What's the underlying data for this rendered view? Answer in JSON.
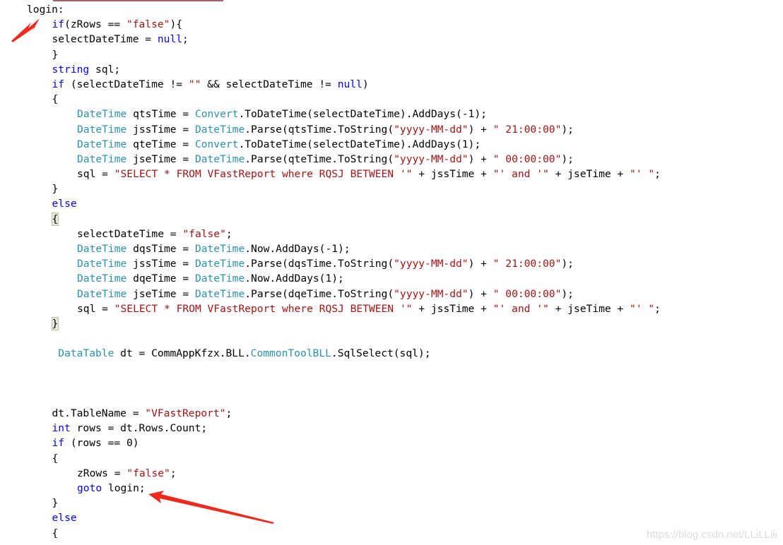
{
  "code_lines": [
    {
      "indent": 0,
      "tokens": [
        [
          "plain",
          "login:"
        ]
      ]
    },
    {
      "indent": 1,
      "tokens": [
        [
          "kw",
          "if"
        ],
        [
          "plain",
          "(zRows == "
        ],
        [
          "str",
          "\"false\""
        ],
        [
          "plain",
          "){"
        ]
      ]
    },
    {
      "indent": 1,
      "tokens": [
        [
          "plain",
          "selectDateTime = "
        ],
        [
          "kw",
          "null"
        ],
        [
          "plain",
          ";"
        ]
      ]
    },
    {
      "indent": 1,
      "tokens": [
        [
          "plain",
          "}"
        ]
      ]
    },
    {
      "indent": 1,
      "tokens": [
        [
          "kw",
          "string"
        ],
        [
          "plain",
          " sql;"
        ]
      ]
    },
    {
      "indent": 1,
      "tokens": [
        [
          "kw",
          "if"
        ],
        [
          "plain",
          " (selectDateTime != "
        ],
        [
          "str",
          "\"\""
        ],
        [
          "plain",
          " && selectDateTime != "
        ],
        [
          "kw",
          "null"
        ],
        [
          "plain",
          ")"
        ]
      ]
    },
    {
      "indent": 1,
      "tokens": [
        [
          "plain",
          "{"
        ]
      ]
    },
    {
      "indent": 2,
      "tokens": [
        [
          "type",
          "DateTime"
        ],
        [
          "plain",
          " qtsTime = "
        ],
        [
          "type",
          "Convert"
        ],
        [
          "plain",
          ".ToDateTime(selectDateTime).AddDays(-1);"
        ]
      ]
    },
    {
      "indent": 2,
      "tokens": [
        [
          "type",
          "DateTime"
        ],
        [
          "plain",
          " jssTime = "
        ],
        [
          "type",
          "DateTime"
        ],
        [
          "plain",
          ".Parse(qtsTime.ToString("
        ],
        [
          "str",
          "\"yyyy-MM-dd\""
        ],
        [
          "plain",
          ") + "
        ],
        [
          "str",
          "\" 21:00:00\""
        ],
        [
          "plain",
          ");"
        ]
      ]
    },
    {
      "indent": 2,
      "tokens": [
        [
          "type",
          "DateTime"
        ],
        [
          "plain",
          " qteTime = "
        ],
        [
          "type",
          "Convert"
        ],
        [
          "plain",
          ".ToDateTime(selectDateTime).AddDays(1);"
        ]
      ]
    },
    {
      "indent": 2,
      "tokens": [
        [
          "type",
          "DateTime"
        ],
        [
          "plain",
          " jseTime = "
        ],
        [
          "type",
          "DateTime"
        ],
        [
          "plain",
          ".Parse(qteTime.ToString("
        ],
        [
          "str",
          "\"yyyy-MM-dd\""
        ],
        [
          "plain",
          ") + "
        ],
        [
          "str",
          "\" 00:00:00\""
        ],
        [
          "plain",
          ");"
        ]
      ]
    },
    {
      "indent": 2,
      "tokens": [
        [
          "plain",
          "sql = "
        ],
        [
          "str",
          "\"SELECT * FROM VFastReport where RQSJ BETWEEN '\""
        ],
        [
          "plain",
          " + jssTime + "
        ],
        [
          "str",
          "\"' and '\""
        ],
        [
          "plain",
          " + jseTime + "
        ],
        [
          "str",
          "\"' \""
        ],
        [
          "plain",
          ";"
        ]
      ]
    },
    {
      "indent": 1,
      "tokens": [
        [
          "plain",
          "}"
        ]
      ]
    },
    {
      "indent": 1,
      "tokens": [
        [
          "kw",
          "else"
        ]
      ]
    },
    {
      "indent": 1,
      "tokens": [
        [
          "hl",
          "{"
        ]
      ]
    },
    {
      "indent": 2,
      "tokens": [
        [
          "plain",
          "selectDateTime = "
        ],
        [
          "str",
          "\"false\""
        ],
        [
          "plain",
          ";"
        ]
      ]
    },
    {
      "indent": 2,
      "tokens": [
        [
          "type",
          "DateTime"
        ],
        [
          "plain",
          " dqsTime = "
        ],
        [
          "type",
          "DateTime"
        ],
        [
          "plain",
          ".Now.AddDays(-1);"
        ]
      ]
    },
    {
      "indent": 2,
      "tokens": [
        [
          "type",
          "DateTime"
        ],
        [
          "plain",
          " jssTime = "
        ],
        [
          "type",
          "DateTime"
        ],
        [
          "plain",
          ".Parse(dqsTime.ToString("
        ],
        [
          "str",
          "\"yyyy-MM-dd\""
        ],
        [
          "plain",
          ") + "
        ],
        [
          "str",
          "\" 21:00:00\""
        ],
        [
          "plain",
          ");"
        ]
      ]
    },
    {
      "indent": 2,
      "tokens": [
        [
          "type",
          "DateTime"
        ],
        [
          "plain",
          " dqeTime = "
        ],
        [
          "type",
          "DateTime"
        ],
        [
          "plain",
          ".Now.AddDays(1);"
        ]
      ]
    },
    {
      "indent": 2,
      "tokens": [
        [
          "type",
          "DateTime"
        ],
        [
          "plain",
          " jseTime = "
        ],
        [
          "type",
          "DateTime"
        ],
        [
          "plain",
          ".Parse(dqeTime.ToString("
        ],
        [
          "str",
          "\"yyyy-MM-dd\""
        ],
        [
          "plain",
          ") + "
        ],
        [
          "str",
          "\" 00:00:00\""
        ],
        [
          "plain",
          ");"
        ]
      ]
    },
    {
      "indent": 2,
      "tokens": [
        [
          "plain",
          "sql = "
        ],
        [
          "str",
          "\"SELECT * FROM VFastReport where RQSJ BETWEEN '\""
        ],
        [
          "plain",
          " + jssTime + "
        ],
        [
          "str",
          "\"' and '\""
        ],
        [
          "plain",
          " + jseTime + "
        ],
        [
          "str",
          "\"' \""
        ],
        [
          "plain",
          ";"
        ]
      ]
    },
    {
      "indent": 1,
      "tokens": [
        [
          "hl",
          "}"
        ]
      ]
    },
    {
      "indent": 0,
      "tokens": []
    },
    {
      "indent": 1,
      "tokens": [
        [
          "plain",
          " "
        ],
        [
          "type",
          "DataTable"
        ],
        [
          "plain",
          " dt = CommAppKfzx.BLL."
        ],
        [
          "type",
          "CommonToolBLL"
        ],
        [
          "plain",
          ".SqlSelect(sql);"
        ]
      ]
    },
    {
      "indent": 0,
      "tokens": []
    },
    {
      "indent": 0,
      "tokens": []
    },
    {
      "indent": 0,
      "tokens": []
    },
    {
      "indent": 1,
      "tokens": [
        [
          "plain",
          "dt.TableName = "
        ],
        [
          "str",
          "\"VFastReport\""
        ],
        [
          "plain",
          ";"
        ]
      ]
    },
    {
      "indent": 1,
      "tokens": [
        [
          "kw",
          "int"
        ],
        [
          "plain",
          " rows = dt.Rows.Count;"
        ]
      ]
    },
    {
      "indent": 1,
      "tokens": [
        [
          "kw",
          "if"
        ],
        [
          "plain",
          " (rows == 0)"
        ]
      ]
    },
    {
      "indent": 1,
      "tokens": [
        [
          "plain",
          "{"
        ]
      ]
    },
    {
      "indent": 2,
      "tokens": [
        [
          "plain",
          "zRows = "
        ],
        [
          "str",
          "\"false\""
        ],
        [
          "plain",
          ";"
        ]
      ]
    },
    {
      "indent": 2,
      "tokens": [
        [
          "kw",
          "goto"
        ],
        [
          "plain",
          " login;"
        ]
      ]
    },
    {
      "indent": 1,
      "tokens": [
        [
          "plain",
          "}"
        ]
      ]
    },
    {
      "indent": 1,
      "tokens": [
        [
          "kw",
          "else"
        ]
      ]
    },
    {
      "indent": 1,
      "tokens": [
        [
          "plain",
          "{"
        ]
      ]
    }
  ],
  "watermark": "https://blog.csdn.net/LLiLLiii",
  "colors": {
    "keyword": "#0000ff",
    "type": "#2b91af",
    "string": "#a31515",
    "arrow": "#f0281e"
  }
}
